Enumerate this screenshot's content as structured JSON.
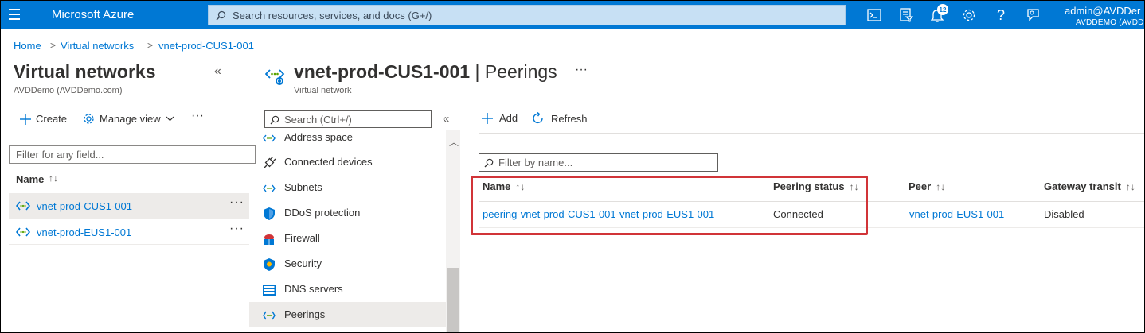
{
  "topbar": {
    "brand": "Microsoft Azure",
    "search_placeholder": "Search resources, services, and docs (G+/)",
    "notification_count": "12",
    "account_name": "admin@AVDDer",
    "account_directory": "AVDDEMO (AVDDE",
    "icons": [
      "cloud-shell-icon",
      "directory-filter-icon",
      "notifications-icon",
      "settings-icon",
      "help-icon",
      "feedback-icon"
    ]
  },
  "breadcrumb": [
    "Home",
    "Virtual networks",
    "vnet-prod-CUS1-001"
  ],
  "left_pane": {
    "title": "Virtual networks",
    "subtitle": "AVDDemo (AVDDemo.com)",
    "toolbar": {
      "create": "Create",
      "manage_view": "Manage view"
    },
    "filter_placeholder": "Filter for any field...",
    "column_name": "Name",
    "items": [
      {
        "name": "vnet-prod-CUS1-001",
        "selected": true
      },
      {
        "name": "vnet-prod-EUS1-001",
        "selected": false
      }
    ]
  },
  "blade": {
    "resource_name": "vnet-prod-CUS1-001",
    "separator": " | ",
    "page": "Peerings",
    "resource_type": "Virtual network",
    "menu_search_placeholder": "Search (Ctrl+/)",
    "menu": [
      {
        "label": "Address space",
        "icon": "address-space-icon"
      },
      {
        "label": "Connected devices",
        "icon": "plug-icon"
      },
      {
        "label": "Subnets",
        "icon": "subnets-icon"
      },
      {
        "label": "DDoS protection",
        "icon": "shield-icon"
      },
      {
        "label": "Firewall",
        "icon": "firewall-icon"
      },
      {
        "label": "Security",
        "icon": "security-icon"
      },
      {
        "label": "DNS servers",
        "icon": "dns-icon"
      },
      {
        "label": "Peerings",
        "icon": "peerings-icon",
        "selected": true
      }
    ]
  },
  "content": {
    "toolbar": {
      "add": "Add",
      "refresh": "Refresh"
    },
    "filter_placeholder": "Filter by name...",
    "columns": [
      "Name",
      "Peering status",
      "Peer",
      "Gateway transit"
    ],
    "rows": [
      {
        "name": "peering-vnet-prod-CUS1-001-vnet-prod-EUS1-001",
        "status": "Connected",
        "peer": "vnet-prod-EUS1-001",
        "gateway_transit": "Disabled"
      }
    ]
  },
  "colors": {
    "azure_blue": "#0078d4",
    "highlight_red": "#d13438",
    "selected_row": "#edebe9"
  }
}
